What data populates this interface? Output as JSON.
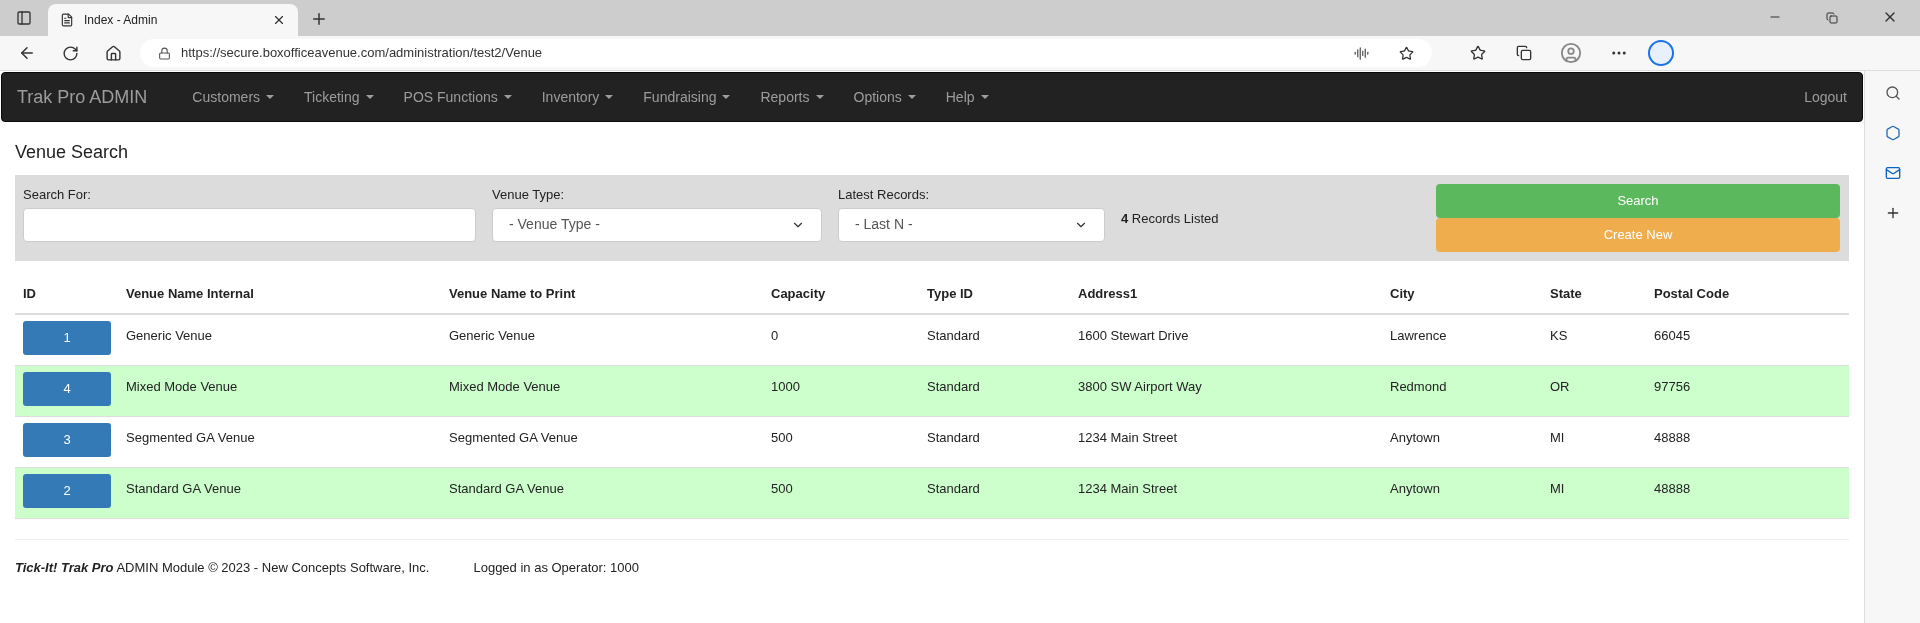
{
  "browser": {
    "tab_title": "Index - Admin",
    "url": "https://secure.boxofficeavenue.com/administration/test2/Venue"
  },
  "navbar": {
    "brand": "Trak Pro ADMIN",
    "menus": [
      {
        "label": "Customers"
      },
      {
        "label": "Ticketing"
      },
      {
        "label": "POS Functions"
      },
      {
        "label": "Inventory"
      },
      {
        "label": "Fundraising"
      },
      {
        "label": "Reports"
      },
      {
        "label": "Options"
      },
      {
        "label": "Help"
      }
    ],
    "logout": "Logout"
  },
  "page_title": "Venue Search",
  "search_panel": {
    "search_for": {
      "label": "Search For:"
    },
    "venue_type": {
      "label": "Venue Type:",
      "value": "- Venue Type -"
    },
    "latest_records": {
      "label": "Latest Records:",
      "value": "- Last N -"
    },
    "records_listed": "**4** Records Listed",
    "search_button": "Search",
    "create_button": "Create New"
  },
  "table": {
    "columns": [
      "ID",
      "Venue Name Internal",
      "Venue Name to Print",
      "Capacity",
      "Type ID",
      "Address1",
      "City",
      "State",
      "Postal Code"
    ],
    "rows": [
      {
        "cells": [
          "1",
          "Generic Venue",
          "Generic Venue",
          "0",
          "Standard",
          "1600 Stewart Drive",
          "Lawrence",
          "KS",
          "66045"
        ]
      },
      {
        "cells": [
          "4",
          "Mixed Mode Venue",
          "Mixed Mode Venue",
          "1000",
          "Standard",
          "3800 SW Airport Way",
          "Redmond",
          "OR",
          "97756"
        ]
      },
      {
        "cells": [
          "3",
          "Segmented GA Venue",
          "Segmented GA Venue",
          "500",
          "Standard",
          "1234 Main Street",
          "Anytown",
          "MI",
          "48888"
        ]
      },
      {
        "cells": [
          "2",
          "Standard GA Venue",
          "Standard GA Venue",
          "500",
          "Standard",
          "1234 Main Street",
          "Anytown",
          "MI",
          "48888"
        ]
      }
    ]
  },
  "footer": {
    "copyright": "**Tick-It! Trak Pro** ADMIN Module © 2023 - New Concepts Software, Inc.",
    "operator": "Logged in as Operator: 1000"
  }
}
